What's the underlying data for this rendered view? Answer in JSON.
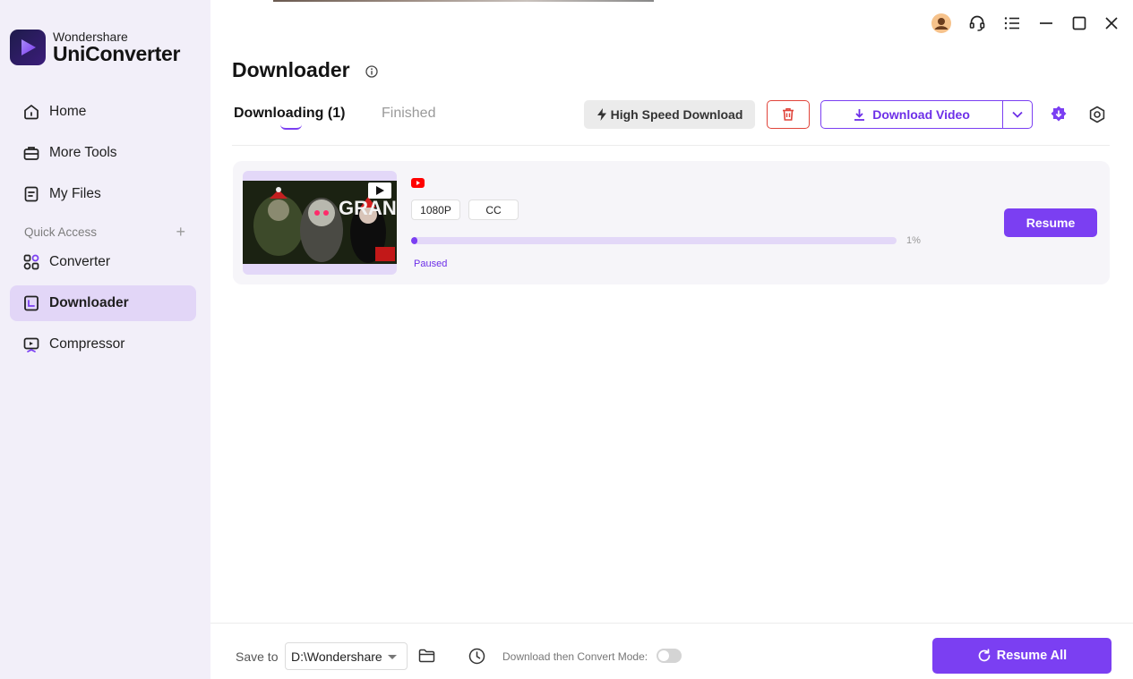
{
  "brand": {
    "top": "Wondershare",
    "main": "UniConverter"
  },
  "sidebar": {
    "items": [
      {
        "label": "Home",
        "icon": "home-icon"
      },
      {
        "label": "More Tools",
        "icon": "toolbox-icon"
      },
      {
        "label": "My Files",
        "icon": "files-icon"
      }
    ],
    "quick_access_label": "Quick Access",
    "quick_items": [
      {
        "label": "Converter",
        "icon": "converter-icon"
      },
      {
        "label": "Downloader",
        "icon": "downloader-icon",
        "active": true
      },
      {
        "label": "Compressor",
        "icon": "compressor-icon"
      }
    ]
  },
  "header": {
    "title": "Downloader",
    "tabs": [
      {
        "label": "Downloading (1)",
        "active": true
      },
      {
        "label": "Finished",
        "active": false
      }
    ],
    "high_speed_label": "High Speed Download",
    "download_video_label": "Download Video"
  },
  "download_item": {
    "source_icon": "youtube-icon",
    "thumbnail_text": "GRANNY",
    "quality": "1080P",
    "subtitle_tag": "CC",
    "progress": 0.01,
    "percent_label": "1%",
    "status": "Paused",
    "resume_label": "Resume"
  },
  "footer": {
    "save_to_label": "Save to",
    "path": "D:\\Wondershare",
    "mode_label": "Download then Convert Mode:",
    "mode_enabled": false,
    "resume_all_label": "Resume All"
  },
  "colors": {
    "accent": "#7b3ff2",
    "sidebar_bg": "#f2eff9",
    "active_bg": "#e2d6f7",
    "danger": "#e0443a",
    "youtube": "#ff0000"
  }
}
